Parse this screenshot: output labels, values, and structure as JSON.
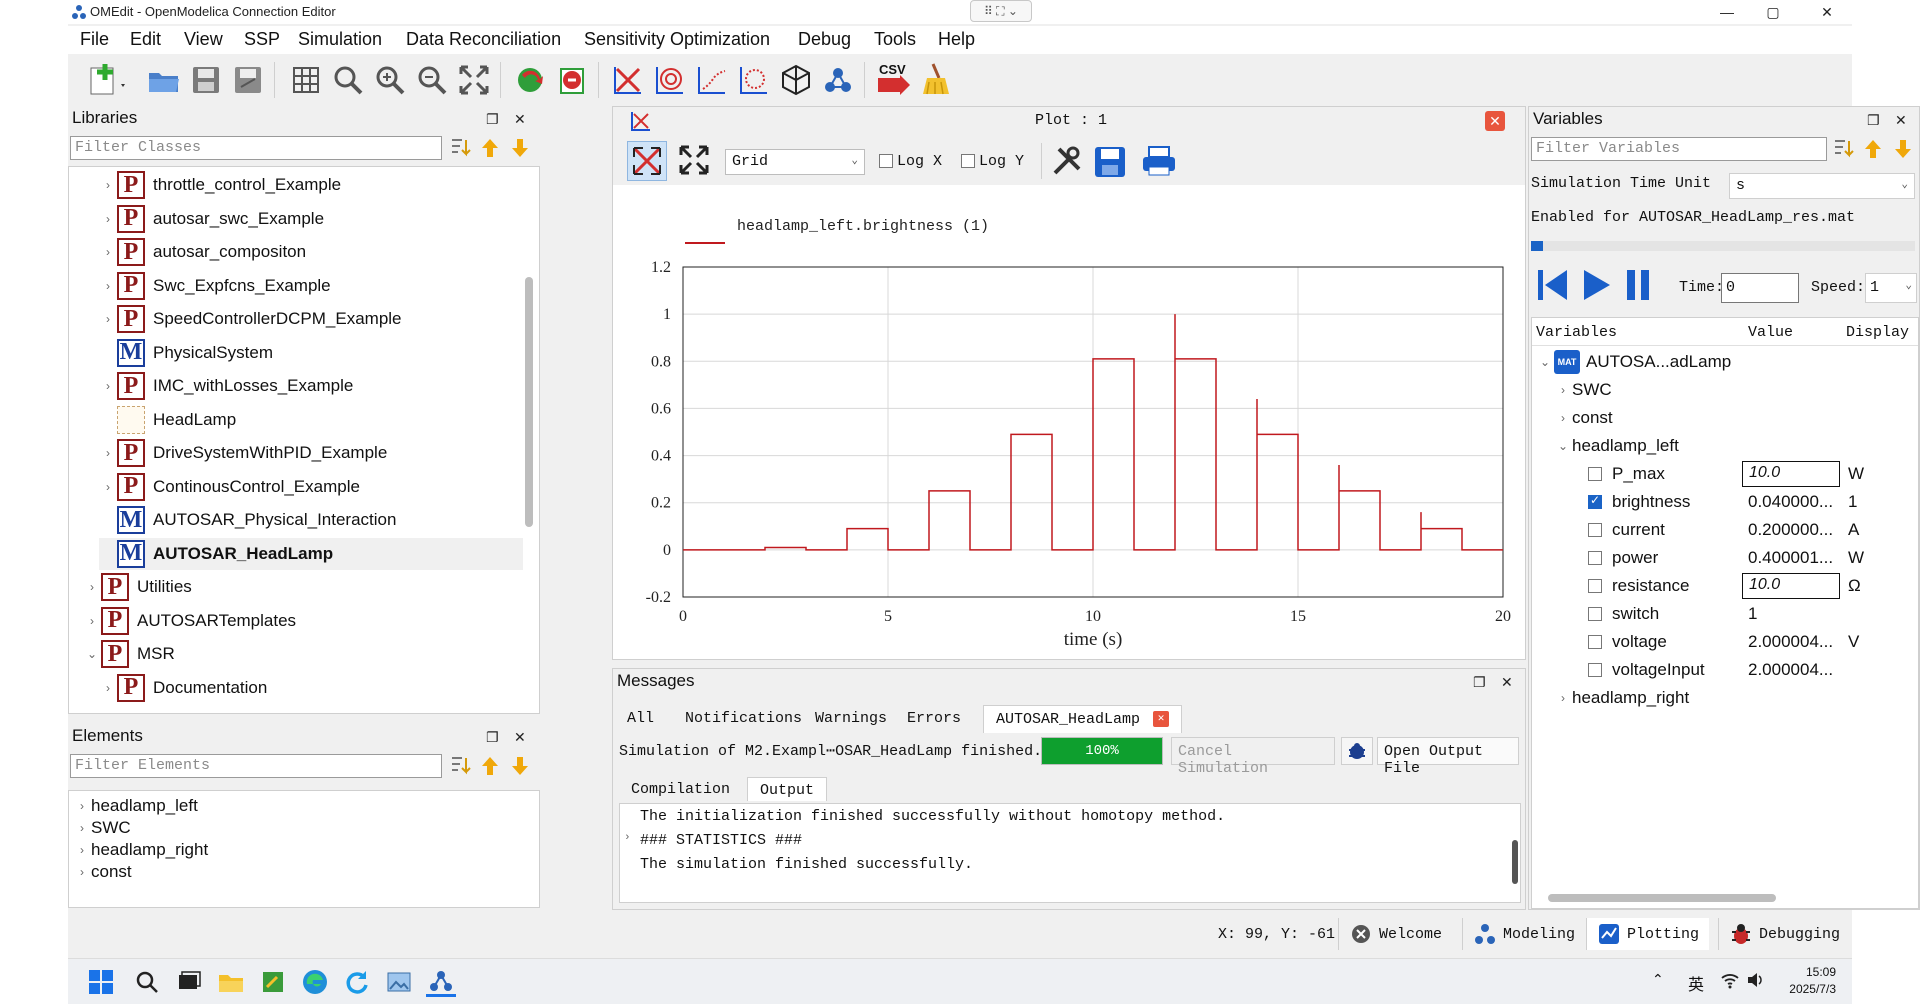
{
  "window": {
    "title": "OMEdit - OpenModelica Connection Editor",
    "controls": {
      "minimize": "—",
      "maximize": "▢",
      "close": "✕"
    },
    "snap_glyph": "⠿ ⛶ ⌄"
  },
  "menu": [
    "File",
    "Edit",
    "View",
    "SSP",
    "Simulation",
    "Data Reconciliation",
    "Sensitivity Optimization",
    "Debug",
    "Tools",
    "Help"
  ],
  "toolbar": {
    "icons": [
      "new-file-icon",
      "open-folder-icon",
      "save-icon",
      "save-all-icon",
      "grid-icon",
      "zoom-reset-icon",
      "zoom-in-icon",
      "zoom-out-icon",
      "fit-icon",
      "check-model-icon",
      "simulate-icon",
      "plot-icon",
      "parametric-plot-icon",
      "array-plot-icon",
      "array-parametric-icon",
      "animation-icon",
      "network-icon",
      "export-csv-icon",
      "clear-icon"
    ],
    "csv_label": "CSV"
  },
  "libraries": {
    "header": "Libraries",
    "filter_placeholder": "Filter Classes",
    "items": [
      {
        "label": "throttle_control_Example",
        "icon": "P",
        "chev": "›",
        "indent": 1
      },
      {
        "label": "autosar_swc_Example",
        "icon": "P",
        "chev": "›",
        "indent": 1
      },
      {
        "label": "autosar_compositon",
        "icon": "P",
        "chev": "›",
        "indent": 1
      },
      {
        "label": "Swc_Expfcns_Example",
        "icon": "P",
        "chev": "›",
        "indent": 1
      },
      {
        "label": "SpeedControllerDCPM_Example",
        "icon": "P",
        "chev": "›",
        "indent": 1
      },
      {
        "label": "PhysicalSystem",
        "icon": "M",
        "chev": "",
        "indent": 1
      },
      {
        "label": "IMC_withLosses_Example",
        "icon": "P",
        "chev": "›",
        "indent": 1
      },
      {
        "label": "HeadLamp",
        "icon": "",
        "chev": "",
        "indent": 1
      },
      {
        "label": "DriveSystemWithPID_Example",
        "icon": "P",
        "chev": "›",
        "indent": 1
      },
      {
        "label": "ContinousControl_Example",
        "icon": "P",
        "chev": "›",
        "indent": 1
      },
      {
        "label": "AUTOSAR_Physical_Interaction",
        "icon": "M",
        "chev": "",
        "indent": 1
      },
      {
        "label": "AUTOSAR_HeadLamp",
        "icon": "M",
        "chev": "",
        "indent": 1,
        "bold": true
      },
      {
        "label": "Utilities",
        "icon": "P",
        "chev": "›",
        "indent": 0
      },
      {
        "label": "AUTOSARTemplates",
        "icon": "P",
        "chev": "›",
        "indent": 0
      },
      {
        "label": "MSR",
        "icon": "P",
        "chev": "⌄",
        "indent": 0
      },
      {
        "label": "Documentation",
        "icon": "P",
        "chev": "›",
        "indent": 1
      }
    ]
  },
  "elements": {
    "header": "Elements",
    "filter_placeholder": "Filter Elements",
    "items": [
      "headlamp_left",
      "SWC",
      "headlamp_right",
      "const"
    ]
  },
  "plot": {
    "title": "Plot : 1",
    "grid_select": "Grid",
    "log_x": "Log X",
    "log_y": "Log Y"
  },
  "chart_data": {
    "type": "line",
    "legend": "headlamp_left.brightness (1)",
    "xlabel": "time (s)",
    "ylabel": "",
    "xlim": [
      0,
      20
    ],
    "ylim": [
      -0.2,
      1.2
    ],
    "xticks": [
      "0",
      "5",
      "10",
      "15",
      "20"
    ],
    "yticks": [
      "-0.2",
      "0",
      "0.2",
      "0.4",
      "0.6",
      "0.8",
      "1",
      "1.2"
    ],
    "series": [
      {
        "name": "headlamp_left.brightness (1)",
        "color": "#c0191e",
        "x": [
          0,
          2,
          2,
          3,
          3,
          4,
          4,
          5,
          5,
          6,
          6,
          7,
          7,
          8,
          8,
          9,
          9,
          10,
          10,
          11,
          11,
          12,
          12,
          12,
          13,
          13,
          14,
          14,
          14,
          15,
          15,
          16,
          16,
          16,
          17,
          17,
          18,
          18,
          18,
          19,
          19,
          20
        ],
        "y": [
          0,
          0,
          0.01,
          0.01,
          0,
          0,
          0.09,
          0.09,
          0,
          0,
          0.25,
          0.25,
          0,
          0,
          0.49,
          0.49,
          0,
          0,
          0.81,
          0.81,
          0,
          0,
          1.0,
          0.81,
          0.81,
          0,
          0,
          0.64,
          0.49,
          0.49,
          0,
          0,
          0.36,
          0.25,
          0.25,
          0,
          0,
          0.16,
          0.09,
          0.09,
          0,
          0
        ]
      }
    ]
  },
  "messages": {
    "header": "Messages",
    "tabs": [
      "All",
      "Notifications",
      "Warnings",
      "Errors",
      "AUTOSAR_HeadLamp"
    ],
    "status": "Simulation of M2.Exampl⋯OSAR_HeadLamp finished.",
    "progress": 100,
    "progress_label": "100%",
    "cancel": "Cancel Simulation",
    "open_output": "Open Output File",
    "subtabs": [
      "Compilation",
      "Output"
    ],
    "lines": [
      "The initialization finished successfully without homotopy method.",
      "### STATISTICS ###",
      "The simulation finished successfully."
    ]
  },
  "variables": {
    "header": "Variables",
    "filter_placeholder": "Filter Variables",
    "time_unit_label": "Simulation Time Unit",
    "time_unit": "s",
    "enabled_for": "Enabled for AUTOSAR_HeadLamp_res.mat",
    "time_label": "Time:",
    "time_value": "0",
    "speed_label": "Speed:",
    "speed_value": "1",
    "columns": [
      "Variables",
      "Value",
      "Display U"
    ],
    "root": "AUTOSA...adLamp",
    "root_badge": "MAT",
    "groups": [
      "SWC",
      "const",
      "headlamp_left"
    ],
    "rows": [
      {
        "name": "P_max",
        "value": "10.0",
        "unit": "W",
        "checked": false,
        "editable": true
      },
      {
        "name": "brightness",
        "value": "0.040000...",
        "unit": "1",
        "checked": true,
        "editable": false
      },
      {
        "name": "current",
        "value": "0.200000...",
        "unit": "A",
        "checked": false,
        "editable": false
      },
      {
        "name": "power",
        "value": "0.400001...",
        "unit": "W",
        "checked": false,
        "editable": false
      },
      {
        "name": "resistance",
        "value": "10.0",
        "unit": "Ω",
        "checked": false,
        "editable": true
      },
      {
        "name": "switch",
        "value": "1",
        "unit": "",
        "checked": false,
        "editable": false
      },
      {
        "name": "voltage",
        "value": "2.000004...",
        "unit": "V",
        "checked": false,
        "editable": false
      },
      {
        "name": "voltageInput",
        "value": "2.000004...",
        "unit": "",
        "checked": false,
        "editable": false
      }
    ],
    "last_group": "headlamp_right"
  },
  "statusbar": {
    "coords": "X: 99, Y: -61",
    "perspectives": [
      "Welcome",
      "Modeling",
      "Plotting",
      "Debugging"
    ]
  },
  "taskbar": {
    "time": "15:09",
    "date": "2025/7/3",
    "ime": "英"
  }
}
